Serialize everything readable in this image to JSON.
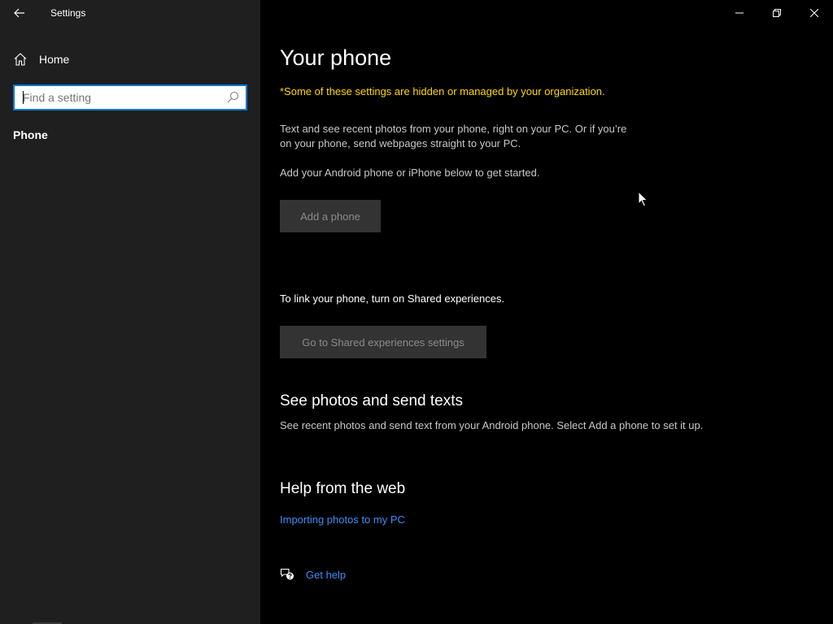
{
  "window": {
    "title": "Settings"
  },
  "sidebar": {
    "home_label": "Home",
    "search": {
      "placeholder": "Find a setting",
      "value": ""
    },
    "section_label": "Phone"
  },
  "main": {
    "title": "Your phone",
    "managed_note": "*Some of these settings are hidden or managed by your organization.",
    "description": "Text and see recent photos from your phone, right on your PC. Or if you’re on your phone, send webpages straight to your PC.",
    "get_started": "Add your Android phone or iPhone below to get started.",
    "add_phone_button": "Add a phone",
    "link_instruction": "To link your phone, turn on Shared experiences.",
    "shared_button": "Go to Shared experiences settings",
    "photos_section": {
      "title": "See photos and send texts",
      "description": "See recent photos and send text from your Android phone. Select Add a phone to set it up."
    },
    "help_section": {
      "title": "Help from the web",
      "link": "Importing photos to my PC"
    },
    "get_help_label": "Get help"
  },
  "icons": {
    "back": "back-arrow-icon",
    "home": "home-icon",
    "search": "search-icon",
    "minimize": "minimize-icon",
    "restore": "restore-icon",
    "close": "close-icon",
    "get_help": "chat-help-icon",
    "cursor": "mouse-cursor-icon"
  },
  "colors": {
    "sidebar_bg": "#1f1f1f",
    "main_bg": "#000000",
    "accent": "#0078d7",
    "warning_text": "#ffd800",
    "link": "#3e8ef7",
    "disabled_button_bg": "#333333"
  }
}
